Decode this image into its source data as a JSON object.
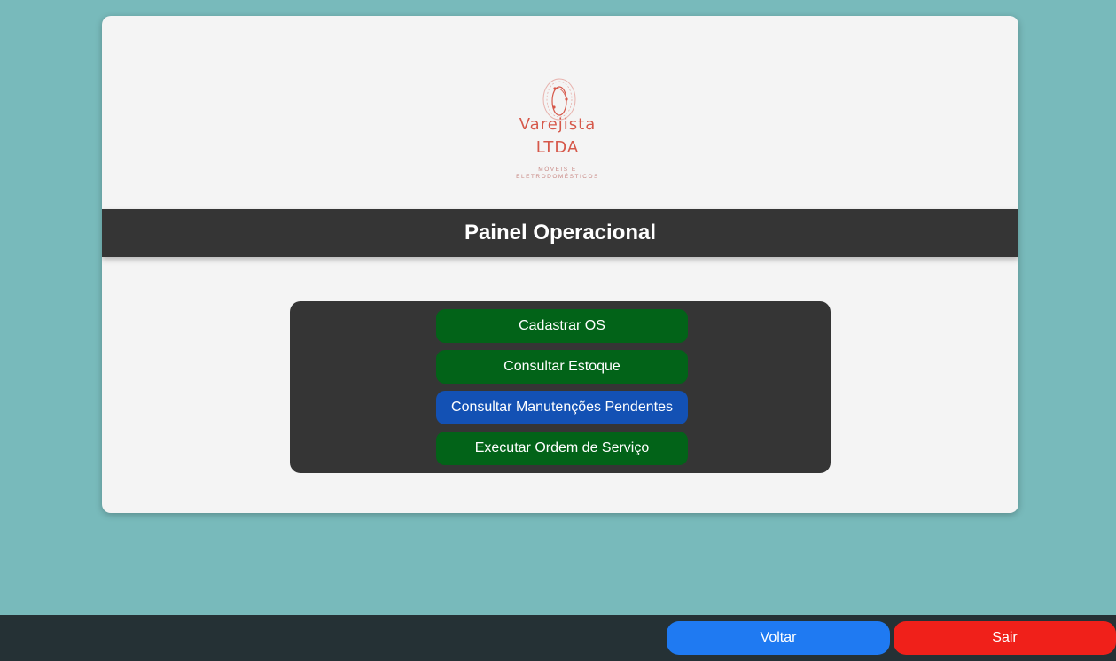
{
  "logo": {
    "line1": "Varejista",
    "line2": "LTDA",
    "sub1": "MÓVEIS E",
    "sub2": "ELETRODOMÉSTICOS",
    "color": "#d6584a"
  },
  "header": {
    "title": "Painel Operacional"
  },
  "menu": {
    "items": [
      {
        "label": "Cadastrar OS",
        "color": "#026318"
      },
      {
        "label": "Consultar Estoque",
        "color": "#026318"
      },
      {
        "label": "Consultar Manutenções Pendentes",
        "color": "#1351b4"
      },
      {
        "label": "Executar Ordem de Serviço",
        "color": "#026318"
      }
    ]
  },
  "footer": {
    "back_label": "Voltar",
    "exit_label": "Sair",
    "back_color": "#1f7af2",
    "exit_color": "#f0201a"
  },
  "colors": {
    "background": "#78babb",
    "card": "#f4f4f4",
    "dark_panel": "#353535",
    "footer": "#253135"
  }
}
